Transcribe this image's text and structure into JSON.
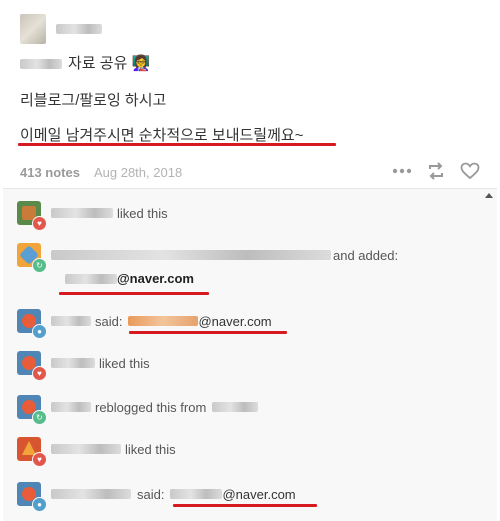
{
  "post": {
    "line1": "자료 공유 👩‍🏫",
    "line2": "리블로그/팔로잉 하시고",
    "line3": "이메일 남겨주시면 순차적으로 보내드릴께요~",
    "notes_count": "413 notes",
    "date": "Aug 28th, 2018"
  },
  "notes": [
    {
      "action": "liked this",
      "badge": "like"
    },
    {
      "action": "and added:",
      "email_domain": "@naver.com",
      "badge": "reblog"
    },
    {
      "action": "said:",
      "email_domain": "@naver.com",
      "badge": "reply"
    },
    {
      "action": "liked this",
      "badge": "like"
    },
    {
      "action": "reblogged this from",
      "badge": "reblog"
    },
    {
      "action": "liked this",
      "badge": "like"
    },
    {
      "action": "said:",
      "email_domain": "@naver.com",
      "badge": "reply"
    }
  ],
  "icons": {
    "like": "heart-icon",
    "reblog": "reblog-icon",
    "reply": "reply-bubble-icon",
    "more": "ellipsis-icon"
  },
  "colors": {
    "highlight_red": "#d71920",
    "like": "#e2574c",
    "reblog": "#56bc8a",
    "reply": "#529ecc"
  }
}
